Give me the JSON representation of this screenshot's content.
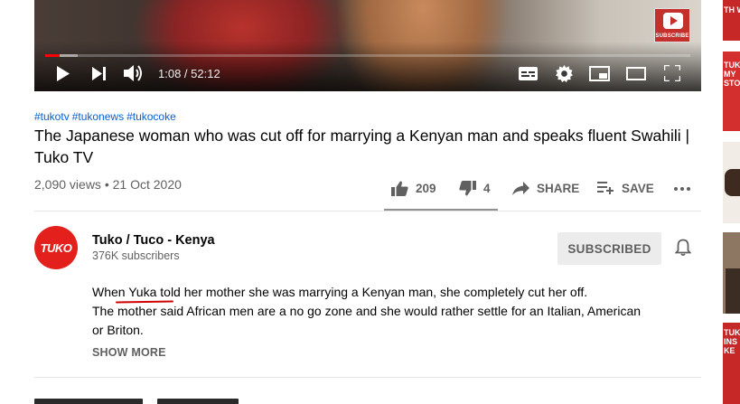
{
  "player": {
    "current_time": "1:08",
    "separator": " / ",
    "duration": "52:12",
    "progress_fraction": 0.022,
    "subscribe_badge": "SUBSCRIBE"
  },
  "video": {
    "hashtags": [
      "#tukotv",
      "#tukonews",
      "#tukocoke"
    ],
    "title": "The Japanese woman who was cut off for marrying a Kenyan man and speaks fluent Swahili | Tuko TV",
    "views": "2,090 views",
    "dot": " • ",
    "date": "21 Oct 2020"
  },
  "actions": {
    "likes": "209",
    "dislikes": "4",
    "share": "SHARE",
    "save": "SAVE"
  },
  "channel": {
    "avatar_text": "TUKO",
    "name": "Tuko / Tuco - Kenya",
    "subscribers": "376K subscribers",
    "subscribed_label": "SUBSCRIBED"
  },
  "description": {
    "line1_a": "Whe",
    "line1_hl": "n Yuka to",
    "line1_b": "ld her mother she was marrying a Kenyan man, she completely cut her off.",
    "line2": "The mother said African men are a no go zone and she would rather settle for an Italian, American or Briton.",
    "show_more": "SHOW MORE"
  },
  "sidebar": {
    "thumb_labels": [
      "TH W A",
      "TUK MY STO",
      "",
      "",
      "TUK INS KE"
    ]
  },
  "colors": {
    "accent_red": "#ff0000",
    "link_blue": "#065fd4",
    "brand_red": "#e3201b",
    "muted_text": "#606060"
  }
}
